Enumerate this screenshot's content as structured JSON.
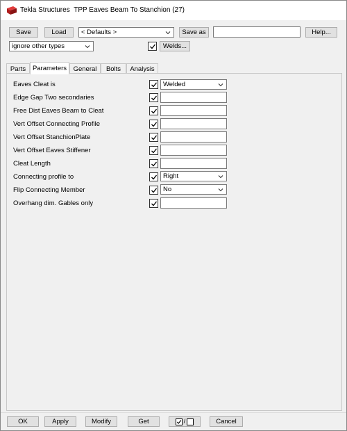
{
  "window": {
    "app_name": "Tekla Structures",
    "dialog_title": "TPP Eaves Beam To Stanchion (27)"
  },
  "toolbar": {
    "save_label": "Save",
    "load_label": "Load",
    "preset_value": "< Defaults >",
    "save_as_label": "Save as",
    "save_as_value": "",
    "help_label": "Help...",
    "filter_value": "ignore other types",
    "welds_checked": true,
    "welds_label": "Welds..."
  },
  "tabs": [
    {
      "label": "Parts",
      "active": false
    },
    {
      "label": "Parameters",
      "active": true
    },
    {
      "label": "General",
      "active": false
    },
    {
      "label": "Bolts",
      "active": false
    },
    {
      "label": "Analysis",
      "active": false
    }
  ],
  "parameters": [
    {
      "label": "Eaves Cleat is",
      "checked": true,
      "control": "select",
      "value": "Welded"
    },
    {
      "label": "Edge Gap Two secondaries",
      "checked": true,
      "control": "text",
      "value": ""
    },
    {
      "label": "Free Dist Eaves Beam to Cleat",
      "checked": true,
      "control": "text",
      "value": ""
    },
    {
      "label": "Vert Offset Connecting Profile",
      "checked": true,
      "control": "text",
      "value": ""
    },
    {
      "label": "Vert Offset StanchionPlate",
      "checked": true,
      "control": "text",
      "value": ""
    },
    {
      "label": "Vert Offset Eaves Stiffener",
      "checked": true,
      "control": "text",
      "value": ""
    },
    {
      "label": "Cleat Length",
      "checked": true,
      "control": "text",
      "value": ""
    },
    {
      "label": "Connecting profile to",
      "checked": true,
      "control": "select",
      "value": "Right"
    },
    {
      "label": "Flip Connecting Member",
      "checked": true,
      "control": "select",
      "value": "No"
    },
    {
      "label": "Overhang dim. Gables only",
      "checked": true,
      "control": "text",
      "value": ""
    }
  ],
  "footer": {
    "ok_label": "OK",
    "apply_label": "Apply",
    "modify_label": "Modify",
    "get_label": "Get",
    "toggle_label": "/",
    "cancel_label": "Cancel"
  },
  "colors": {
    "title_bg": "#ffffff",
    "dialog_bg": "#f0f0f0",
    "button_bg": "#e1e1e1",
    "app_icon": "#d42a2a"
  }
}
